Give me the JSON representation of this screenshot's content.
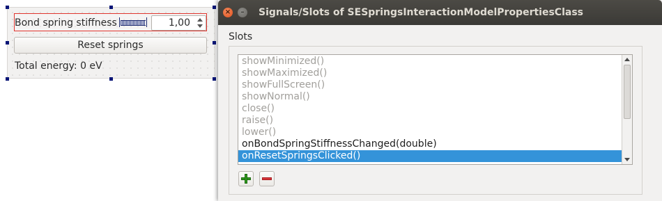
{
  "form": {
    "bond_label": "Bond spring stiffness",
    "stiffness_value": "1,00",
    "reset_label": "Reset springs",
    "energy_label": "Total energy: 0 eV"
  },
  "dialog": {
    "title": "Signals/Slots of SESpringsInteractionModelPropertiesClass",
    "section_label": "Slots",
    "slots": [
      {
        "label": "showMinimized()",
        "state": "disabled"
      },
      {
        "label": "showMaximized()",
        "state": "disabled"
      },
      {
        "label": "showFullScreen()",
        "state": "disabled"
      },
      {
        "label": "showNormal()",
        "state": "disabled"
      },
      {
        "label": "close()",
        "state": "disabled"
      },
      {
        "label": "raise()",
        "state": "disabled"
      },
      {
        "label": "lower()",
        "state": "disabled"
      },
      {
        "label": "onBondSpringStiffnessChanged(double)",
        "state": "enabled"
      },
      {
        "label": "onResetSpringsClicked()",
        "state": "selected"
      }
    ]
  },
  "colors": {
    "selection": "#3493d9",
    "selection_border": "#e0352e",
    "handle": "#0a1677",
    "titlebar": "#3b3a36",
    "close_button": "#e0511e"
  },
  "icons": [
    "close-icon",
    "minimize-icon",
    "plus-icon",
    "minus-icon",
    "scroll-up-icon",
    "scroll-down-icon",
    "spin-up-icon",
    "spin-down-icon"
  ]
}
